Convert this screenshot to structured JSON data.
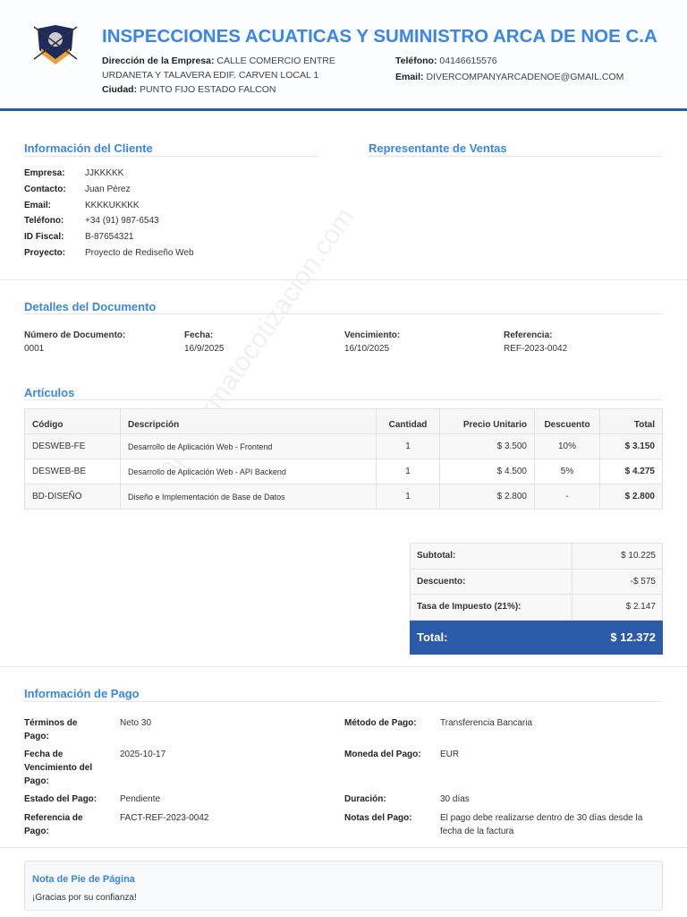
{
  "company": {
    "name": "INSPECCIONES ACUATICAS Y SUMINISTRO ARCA DE NOE C.A",
    "address_label": "Dirección de la Empresa:",
    "address": "CALLE COMERCIO ENTRE URDANETA Y TALAVERA EDIF. CARVEN LOCAL 1",
    "city_label": "Ciudad:",
    "city": "PUNTO FIJO ESTADO FALCON",
    "phone_label": "Teléfono:",
    "phone": "04146615576",
    "email_label": "Email:",
    "email": "DIVERCOMPANYARCADENOE@GMAIL.COM"
  },
  "client": {
    "title": "Información del Cliente",
    "fields": [
      {
        "k": "Empresa:",
        "v": "JJKKKKK"
      },
      {
        "k": "Contacto:",
        "v": "Juan Pérez"
      },
      {
        "k": "Email:",
        "v": "KKKKUKKKK"
      },
      {
        "k": "Teléfono:",
        "v": "+34 (91) 987-6543"
      },
      {
        "k": "ID Fiscal:",
        "v": "B-87654321"
      },
      {
        "k": "Proyecto:",
        "v": "Proyecto de Rediseño Web"
      }
    ]
  },
  "sales": {
    "title": "Representante de Ventas"
  },
  "doc": {
    "title": "Detalles del Documento",
    "fields": [
      {
        "k": "Número de Documento:",
        "v": "0001"
      },
      {
        "k": "Fecha:",
        "v": "16/9/2025"
      },
      {
        "k": "Vencimiento:",
        "v": "16/10/2025"
      },
      {
        "k": "Referencia:",
        "v": "REF-2023-0042"
      }
    ]
  },
  "items": {
    "title": "Artículos",
    "headers": [
      "Código",
      "Descripción",
      "Cantidad",
      "Precio Unitario",
      "Descuento",
      "Total"
    ],
    "rows": [
      [
        "DESWEB-FE",
        "Desarrollo de Aplicación Web - Frontend",
        "1",
        "$ 3.500",
        "10%",
        "$ 3.150"
      ],
      [
        "DESWEB-BE",
        "Desarrollo de Aplicación Web - API Backend",
        "1",
        "$ 4.500",
        "5%",
        "$ 4.275"
      ],
      [
        "BD-DISEÑO",
        "Diseño e Implementación de Base de Datos",
        "1",
        "$ 2.800",
        "-",
        "$ 2.800"
      ]
    ]
  },
  "totals": {
    "subtotal_label": "Subtotal:",
    "subtotal": "$ 10.225",
    "discount_label": "Descuento:",
    "discount": "-$ 575",
    "tax_label": "Tasa de Impuesto (21%):",
    "tax": "$ 2.147",
    "total_label": "Total:",
    "total": "$ 12.372"
  },
  "payment": {
    "title": "Información de Pago",
    "left": [
      {
        "k": "Términos de Pago:",
        "v": "Neto 30"
      },
      {
        "k": "Fecha de Vencimiento del Pago:",
        "v": "2025-10-17"
      },
      {
        "k": "Estado del Pago:",
        "v": "Pendiente"
      },
      {
        "k": "Referencia de Pago:",
        "v": "FACT-REF-2023-0042"
      }
    ],
    "right": [
      {
        "k": "Método de Pago:",
        "v": "Transferencia Bancaria"
      },
      {
        "k": "Moneda del Pago:",
        "v": "EUR"
      },
      {
        "k": "Duración:",
        "v": "30 días"
      },
      {
        "k": "Notas del Pago:",
        "v": "El pago debe realizarse dentro de 30 días desde la fecha de la factura"
      }
    ]
  },
  "footer": {
    "title": "Nota de Pie de Página",
    "text": "¡Gracias por su confianza!"
  },
  "watermark": "app.formatocotizacion.com"
}
